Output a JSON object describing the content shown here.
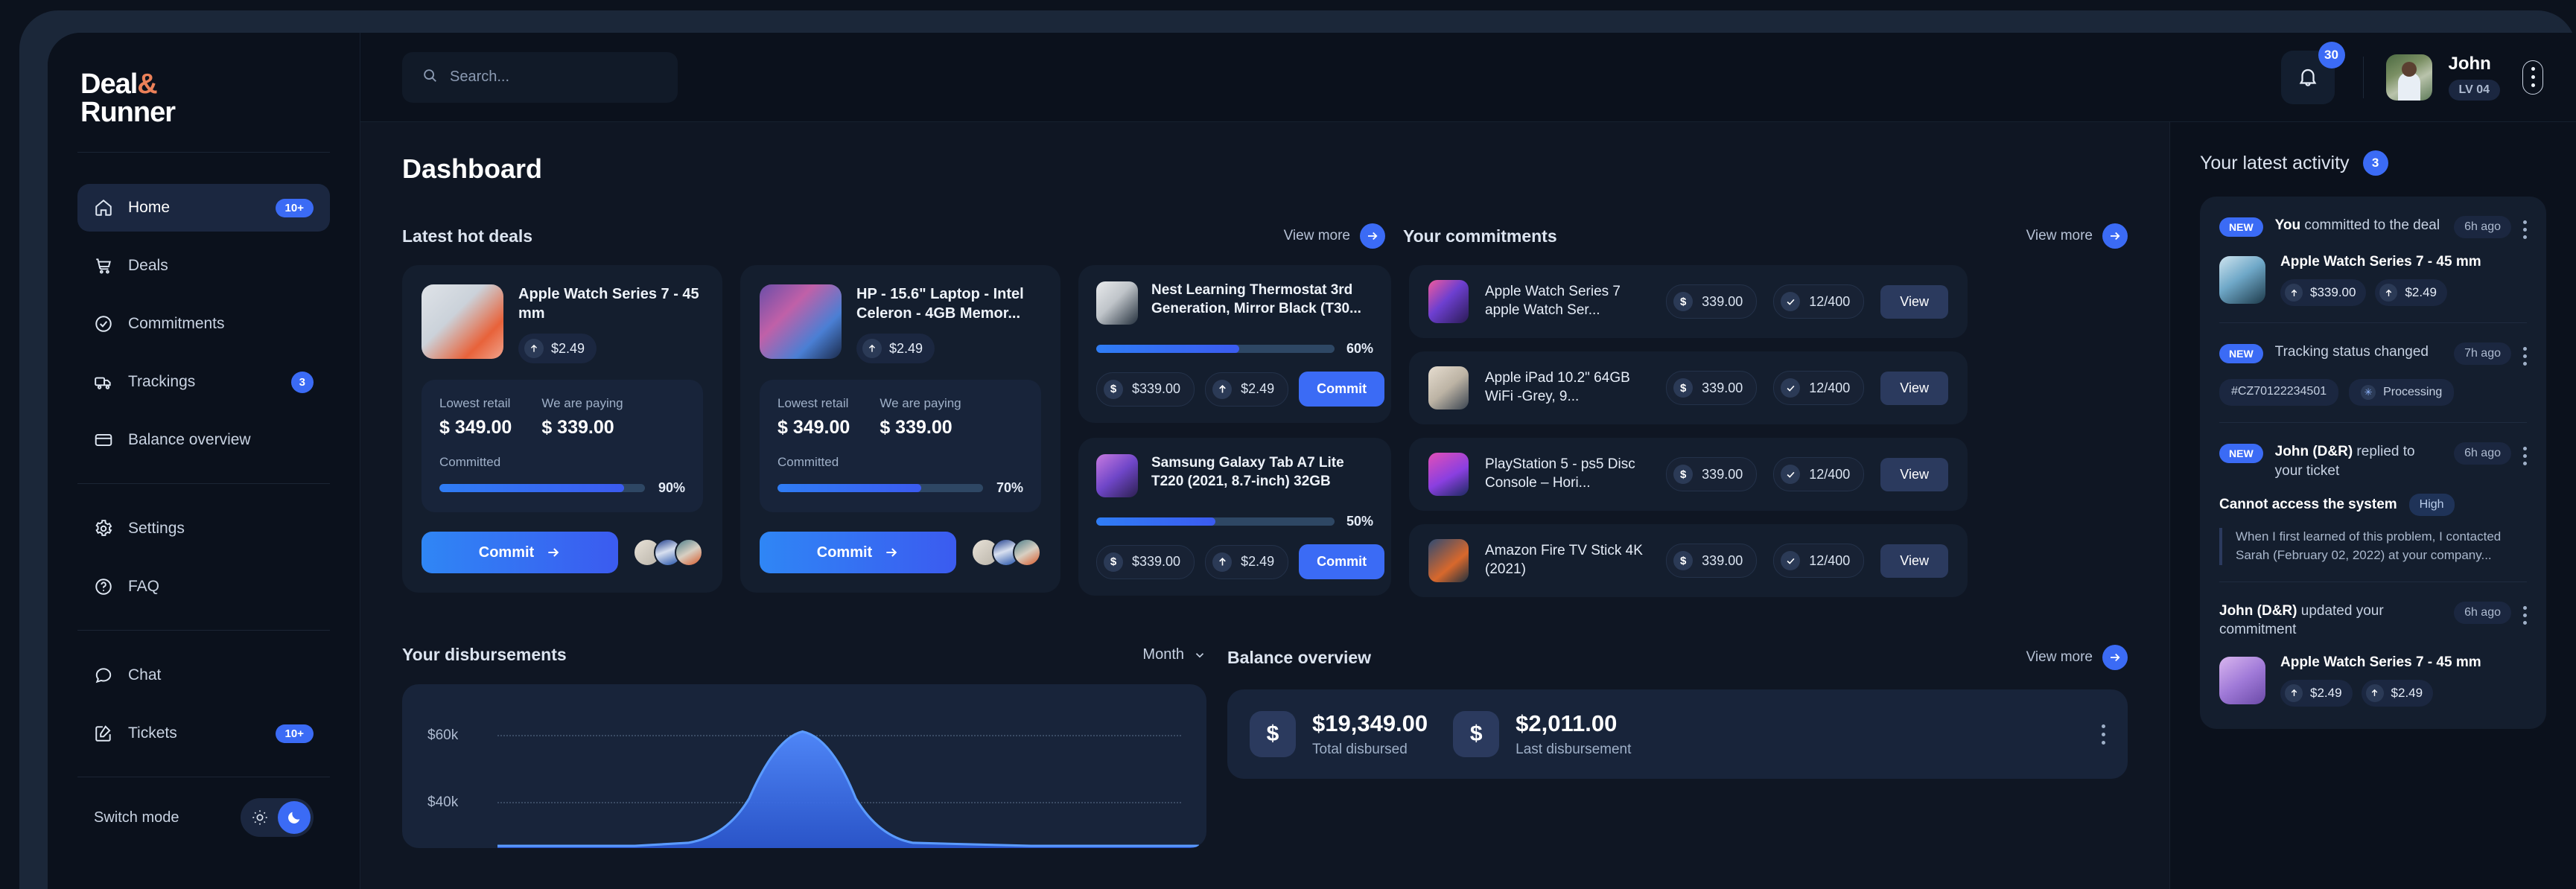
{
  "brand": {
    "line1": "Deal",
    "amp": "&",
    "line2": "Runner"
  },
  "sidebar": {
    "items": [
      {
        "label": "Home",
        "icon": "home-icon",
        "badge": "10+"
      },
      {
        "label": "Deals",
        "icon": "cart-icon",
        "badge": ""
      },
      {
        "label": "Commitments",
        "icon": "check-circle-icon",
        "badge": ""
      },
      {
        "label": "Trackings",
        "icon": "truck-icon",
        "badge": "3"
      },
      {
        "label": "Balance overview",
        "icon": "card-icon",
        "badge": ""
      },
      {
        "label": "Settings",
        "icon": "gear-icon",
        "badge": ""
      },
      {
        "label": "FAQ",
        "icon": "question-circle-icon",
        "badge": ""
      },
      {
        "label": "Chat",
        "icon": "chat-icon",
        "badge": ""
      },
      {
        "label": "Tickets",
        "icon": "edit-square-icon",
        "badge": "10+"
      }
    ],
    "switch_mode_label": "Switch mode"
  },
  "topbar": {
    "search_placeholder": "Search...",
    "search_value": "",
    "notification_count": "30",
    "user_name": "John",
    "user_level": "LV 04"
  },
  "page": {
    "title": "Dashboard"
  },
  "hot_deals": {
    "section_title": "Latest hot deals",
    "view_more": "View more",
    "labels": {
      "lowest_retail": "Lowest retail",
      "we_are_paying": "We are paying",
      "committed": "Committed",
      "commit": "Commit"
    },
    "cards": [
      {
        "title": "Apple Watch Series 7 - 45 mm",
        "delta": "$2.49",
        "lowest_retail": "$ 349.00",
        "we_are_paying": "$ 339.00",
        "progress": "90%"
      },
      {
        "title": "HP - 15.6\" Laptop - Intel Celeron - 4GB Memor...",
        "delta": "$2.49",
        "lowest_retail": "$ 349.00",
        "we_are_paying": "$ 339.00",
        "progress": "70%"
      }
    ],
    "mini_cards": [
      {
        "title": "Nest Learning Thermostat 3rd Generation, Mirror Black (T30...",
        "progress": "60%",
        "price": "$339.00",
        "delta": "$2.49",
        "commit": "Commit"
      },
      {
        "title": "Samsung Galaxy Tab A7 Lite T220 (2021, 8.7-inch) 32GB",
        "progress": "50%",
        "price": "$339.00",
        "delta": "$2.49",
        "commit": "Commit"
      }
    ]
  },
  "commitments": {
    "section_title": "Your commitments",
    "view_more": "View more",
    "view_label": "View",
    "rows": [
      {
        "name": "Apple Watch Series 7 apple Watch Ser...",
        "price": "339.00",
        "qty": "12/400"
      },
      {
        "name": "Apple iPad 10.2\" 64GB WiFi -Grey, 9...",
        "price": "339.00",
        "qty": "12/400"
      },
      {
        "name": "PlayStation 5 - ps5 Disc Console – Hori...",
        "price": "339.00",
        "qty": "12/400"
      },
      {
        "name": "Amazon Fire TV Stick 4K (2021)",
        "price": "339.00",
        "qty": "12/400"
      }
    ]
  },
  "disbursements": {
    "section_title": "Your disbursements",
    "period": "Month"
  },
  "chart_data": {
    "type": "area",
    "title": "Your disbursements",
    "xlabel": "",
    "ylabel": "",
    "ytick_labels": [
      "$60k",
      "$40k"
    ],
    "ytick_values": [
      60000,
      40000
    ],
    "ylim": [
      0,
      70000
    ],
    "grid": true,
    "legend": "none",
    "x": [
      0,
      1,
      2,
      3,
      4,
      5,
      6,
      7,
      8,
      9,
      10
    ],
    "values": [
      2000,
      2000,
      2000,
      5000,
      20000,
      52000,
      22000,
      5000,
      2000,
      2000,
      2000
    ]
  },
  "balance": {
    "section_title": "Balance overview",
    "view_more": "View more",
    "total_value": "$19,349.00",
    "total_label": "Total disbursed",
    "last_value": "$2,011.00",
    "last_label": "Last disbursement"
  },
  "activity": {
    "section_title": "Your latest activity",
    "count": "3",
    "new_label": "NEW",
    "items": [
      {
        "actor": "You",
        "action": " committed to the deal",
        "time": "6h ago",
        "is_new": true,
        "product": "Apple Watch Series 7 - 45 mm",
        "pill1": "$339.00",
        "pill2": "$2.49"
      },
      {
        "actor": "",
        "action": "Tracking status changed",
        "time": "7h ago",
        "is_new": true,
        "tag_id": "#CZ70122234501",
        "tag_status": "Processing"
      },
      {
        "actor": "John (D&R)",
        "action": " replied to your ticket",
        "time": "6h ago",
        "is_new": true,
        "ticket_title": "Cannot access the system",
        "priority": "High",
        "quote": "When I first learned of this problem, I contacted Sarah (February 02, 2022) at your company..."
      },
      {
        "actor": "John (D&R)",
        "action": " updated your commitment",
        "time": "6h ago",
        "is_new": false,
        "product": "Apple Watch Series 7 - 45 mm",
        "pill1": "$2.49",
        "pill2": "$2.49"
      }
    ]
  },
  "colors": {
    "accent": "#3b6bf5",
    "brand_amp": "#ec8159",
    "bg": "#0b111c",
    "card": "#141e2e",
    "panel": "#18243a"
  }
}
